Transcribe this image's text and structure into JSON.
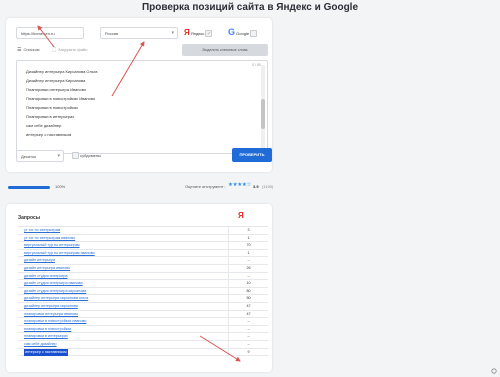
{
  "page_title": "Проверка позиций сайта в Яндекс и Google",
  "form": {
    "site_value": "https://home-vrn.ru",
    "region_value": "Россия",
    "yandex_label": "Яндекс",
    "google_label": "Google",
    "yandex_logo": "Я",
    "google_logo": "G",
    "tab_list": "Списком",
    "tab_file": "Загрузить файл",
    "highlight_button": "Выделить ключевые слова",
    "counter": "0 / 50",
    "keywords": [
      "Дизайнер интерьера Кирсанова Ольга",
      "Дизайнер интерьера Кирсанова",
      "Планировки интерьера Иваново",
      "Планировки в новостройках Иваново",
      "Планировки в новостройках",
      "Планировки в интерьерах",
      "сам себе дизайнер",
      "интерьер с наставником"
    ],
    "depth_value": "Десяток",
    "subdomains_label": "субдомены",
    "check_button": "ПРОВЕРИТЬ"
  },
  "status": {
    "progress_percent": 100,
    "progress_label": "100%",
    "rating_label": "Оцените инструмент:",
    "stars": "★★★★☆",
    "rating_value": "3.9",
    "votes": "(1190)"
  },
  "results": {
    "title": "Запросы",
    "engine_logo": "Я",
    "rows": [
      {
        "kw": "ут тог по интерьерам",
        "pos": "3"
      },
      {
        "kw": "ут тог по интерьерам иваново",
        "pos": "1"
      },
      {
        "kw": "виртуальный тур по интерьерам",
        "pos": "70"
      },
      {
        "kw": "виртуальный тур по интерьерам иваново",
        "pos": "1"
      },
      {
        "kw": "дизайн интерьера",
        "pos": "–"
      },
      {
        "kw": "дизайн интерьера иваново",
        "pos": "26"
      },
      {
        "kw": "дизайн студия интерьера",
        "pos": "–"
      },
      {
        "kw": "дизайн студия интерьера иваново",
        "pos": "10"
      },
      {
        "kw": "дизайн студия интерьера кирсанова",
        "pos": "80"
      },
      {
        "kw": "дизайнер интерьера кирсанова ольга",
        "pos": "50"
      },
      {
        "kw": "дизайнер интерьера кирсанова",
        "pos": "47"
      },
      {
        "kw": "планировки интерьера иваново",
        "pos": "47"
      },
      {
        "kw": "планировки в новостройках иваново",
        "pos": "–"
      },
      {
        "kw": "планировки в новостройках",
        "pos": "–"
      },
      {
        "kw": "планировки в интерьерах",
        "pos": "–"
      },
      {
        "kw": "сам себе дизайнер",
        "pos": "–"
      },
      {
        "kw": "интерьер с наставником",
        "pos": "9"
      }
    ]
  },
  "colors": {
    "accent": "#1f6cd8",
    "yandex": "#e52620",
    "arrow": "#d9534f",
    "selection": "#1a4fd0"
  }
}
